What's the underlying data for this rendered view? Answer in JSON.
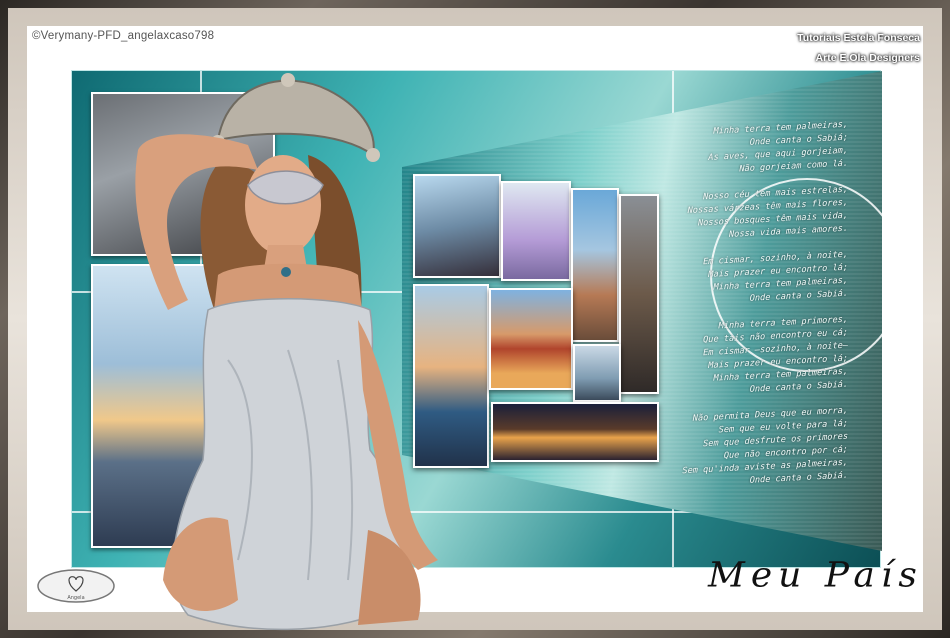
{
  "image": {
    "copyright": "©Verymany-PFD_angelaxcaso798",
    "credit_line_1": "Tutoriais Estela Fonseca",
    "credit_line_2": "Arte E.Ola Designers",
    "title": "Meu País"
  },
  "poem": {
    "stanzas": [
      [
        "Minha terra tem palmeiras,",
        "Onde canta o Sabiá;",
        "As aves, que aqui gorjeiam,",
        "Não gorjeiam como lá."
      ],
      [
        "Nosso céu tem mais estrelas,",
        "Nossas várzeas têm mais flores,",
        "Nossos bosques têm mais vida,",
        "Nossa vida mais amores."
      ],
      [
        "Em cismar, sozinho, à noite,",
        "Mais prazer eu encontro lá;",
        "Minha terra tem palmeiras,",
        "Onde canta o Sabiá."
      ],
      [
        "Minha terra tem primores,",
        "Que tais não encontro eu cá;",
        "Em cismar –sozinho, à noite–",
        "Mais prazer eu encontro lá;",
        "Minha terra tem palmeiras,",
        "Onde canta o Sabiá."
      ],
      [
        "Não permita Deus que eu morra,",
        "Sem que eu volte para lá;",
        "Sem que desfrute os primores",
        "Que não encontro por cá;",
        "Sem qu'inda aviste as palmeiras,",
        "Onde canta o Sabiá."
      ]
    ]
  },
  "colors": {
    "teal": "#3fb3b4",
    "frame": "#6e655c",
    "dress": "#cfd3d8",
    "skin": "#d9a07d",
    "hair": "#8a5a35"
  },
  "logo_text": "Angela"
}
